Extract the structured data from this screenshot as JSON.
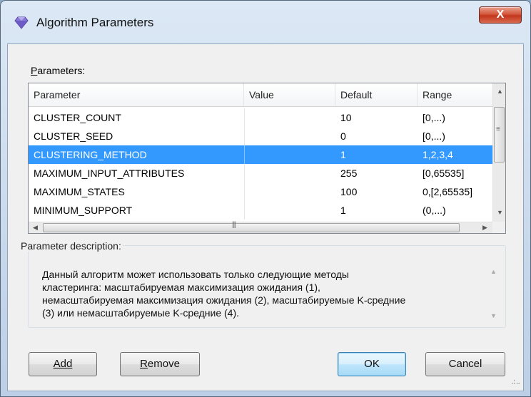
{
  "window": {
    "title": "Algorithm Parameters",
    "icon": "gem-icon",
    "close_label": "X"
  },
  "parameters_label": "Parameters:",
  "table": {
    "columns": [
      "Parameter",
      "Value",
      "Default",
      "Range"
    ],
    "rows": [
      {
        "parameter": "CLUSTER_COUNT",
        "value": "",
        "default": "10",
        "range": "[0,...)",
        "selected": false
      },
      {
        "parameter": "CLUSTER_SEED",
        "value": "",
        "default": "0",
        "range": "[0,...)",
        "selected": false
      },
      {
        "parameter": "CLUSTERING_METHOD",
        "value": "",
        "default": "1",
        "range": "1,2,3,4",
        "selected": true
      },
      {
        "parameter": "MAXIMUM_INPUT_ATTRIBUTES",
        "value": "",
        "default": "255",
        "range": "[0,65535]",
        "selected": false
      },
      {
        "parameter": "MAXIMUM_STATES",
        "value": "",
        "default": "100",
        "range": "0,[2,65535]",
        "selected": false
      },
      {
        "parameter": "MINIMUM_SUPPORT",
        "value": "",
        "default": "1",
        "range": "(0,...)",
        "selected": false
      }
    ]
  },
  "description": {
    "title": "Parameter description:",
    "lines": [
      "Данный алгоритм может использовать только следующие методы",
      "кластеринга: масштабируемая максимизация ожидания (1),",
      "немасштабируемая максимизация ожидания (2), масштабируемые K-средние",
      "(3) или немасштабируемые K-средние (4)."
    ]
  },
  "buttons": {
    "add": "Add",
    "remove": "Remove",
    "ok": "OK",
    "cancel": "Cancel"
  },
  "colors": {
    "selection": "#3399ff",
    "close_button": "#c9452b",
    "dialog_background": "#f0f0f0"
  }
}
